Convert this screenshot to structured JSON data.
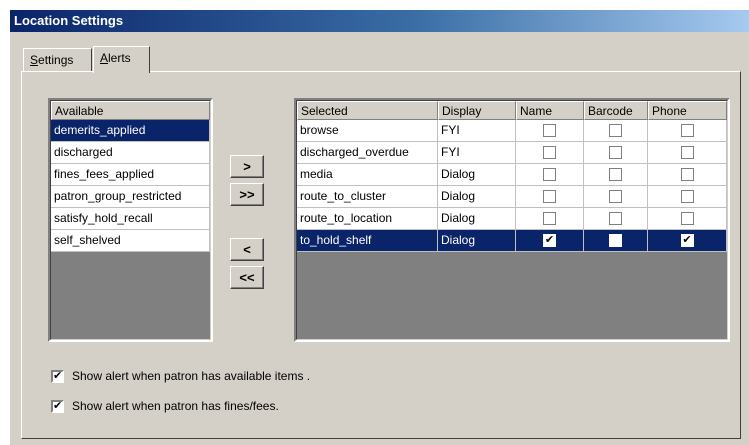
{
  "window": {
    "title": "Location Settings"
  },
  "tabs": [
    {
      "label_u": "S",
      "label_rest": "ettings",
      "active": false
    },
    {
      "label_u": "A",
      "label_rest": "lerts",
      "active": true
    }
  ],
  "available": {
    "header": "Available",
    "items": [
      "demerits_applied",
      "discharged",
      "fines_fees_applied",
      "patron_group_restricted",
      "satisfy_hold_recall",
      "self_shelved"
    ],
    "selected_index": 0
  },
  "buttons": {
    "add": ">",
    "add_all": ">>",
    "remove": "<",
    "remove_all": "<<"
  },
  "selected_table": {
    "headers": [
      "Selected",
      "Display",
      "Name",
      "Barcode",
      "Phone"
    ],
    "rows": [
      {
        "name": "browse",
        "display": "FYI",
        "name_cb": false,
        "barcode_cb": false,
        "phone_cb": false
      },
      {
        "name": "discharged_overdue",
        "display": "FYI",
        "name_cb": false,
        "barcode_cb": false,
        "phone_cb": false
      },
      {
        "name": "media",
        "display": "Dialog",
        "name_cb": false,
        "barcode_cb": false,
        "phone_cb": false
      },
      {
        "name": "route_to_cluster",
        "display": "Dialog",
        "name_cb": false,
        "barcode_cb": false,
        "phone_cb": false
      },
      {
        "name": "route_to_location",
        "display": "Dialog",
        "name_cb": false,
        "barcode_cb": false,
        "phone_cb": false
      },
      {
        "name": "to_hold_shelf",
        "display": "Dialog",
        "name_cb": true,
        "barcode_cb": false,
        "phone_cb": true
      }
    ],
    "selected_index": 5,
    "check_glyph": "✔"
  },
  "options": {
    "available_items_label": "Show alert when patron has available items .",
    "available_items_checked": true,
    "fines_fees_label": "Show alert when patron has fines/fees.",
    "fines_fees_checked": true
  },
  "colors": {
    "selection": "#0a246a",
    "face": "#d4d0c8",
    "empty_list": "#808080"
  }
}
